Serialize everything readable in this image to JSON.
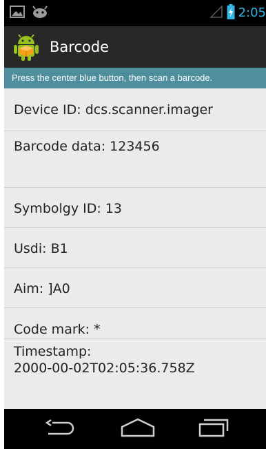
{
  "status_bar": {
    "time": "2:05",
    "notification_icons": [
      "picture-icon",
      "android-icon"
    ],
    "system_icons": [
      "signal-icon",
      "battery-icon"
    ],
    "accent_color": "#33b5e5"
  },
  "action_bar": {
    "title": "Barcode",
    "logo_icon": "android-barcode-logo-icon"
  },
  "instruction": {
    "text": "Press the center blue button, then scan a barcode.",
    "background_color": "#4e8e9d"
  },
  "info": {
    "device_id": "Device ID: dcs.scanner.imager",
    "barcode_data": "Barcode data: 123456",
    "symbology_id": "Symbolgy ID: 13",
    "usdi": "Usdi: B1",
    "aim": "Aim: ]A0",
    "code_mark": "Code mark: *",
    "timestamp_label": "Timestamp:",
    "timestamp_value": "2000-00-02T02:05:36.758Z"
  },
  "nav_bar": {
    "buttons": [
      "back-icon",
      "home-icon",
      "recent-apps-icon"
    ]
  }
}
